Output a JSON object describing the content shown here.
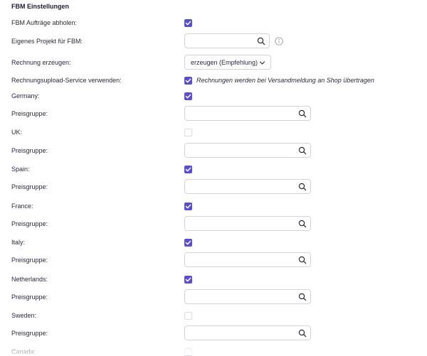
{
  "section_title": "FBM Einstellungen",
  "fbm_auftraege": {
    "label": "FBM Aufträge abholen:",
    "checked": true
  },
  "eigenes_projekt": {
    "label": "Eigenes Projekt für FBM:",
    "value": "",
    "icon": "search-icon",
    "info_icon": "info-icon"
  },
  "rechnung": {
    "label": "Rechnung erzeugen:",
    "selected": "erzeugen (Empfehlung)",
    "icon": "chevron-down-icon"
  },
  "rechnungsupload": {
    "label": "Rechnungsupload-Service verwenden:",
    "checked": true,
    "note": "Rechnungen werden bei Versandmeldung an Shop übertragen"
  },
  "countries": [
    {
      "name": "Germany:",
      "checked": true,
      "preis_label": "Preisgruppe:",
      "preis_value": ""
    },
    {
      "name": "UK:",
      "checked": false,
      "preis_label": "Preisgruppe:",
      "preis_value": ""
    },
    {
      "name": "Spain:",
      "checked": true,
      "preis_label": "Preisgruppe:",
      "preis_value": ""
    },
    {
      "name": "France:",
      "checked": true,
      "preis_label": "Preisgruppe:",
      "preis_value": ""
    },
    {
      "name": "Italy:",
      "checked": true,
      "preis_label": "Preisgruppe:",
      "preis_value": ""
    },
    {
      "name": "Netherlands:",
      "checked": true,
      "preis_label": "Preisgruppe:",
      "preis_value": ""
    },
    {
      "name": "Sweden:",
      "checked": false,
      "preis_label": "Preisgruppe:",
      "preis_value": ""
    },
    {
      "name": "Canada:",
      "checked": false
    }
  ],
  "colors": {
    "accent": "#5b4fc9",
    "border": "#d3d3da",
    "text": "#2a2a3a"
  }
}
